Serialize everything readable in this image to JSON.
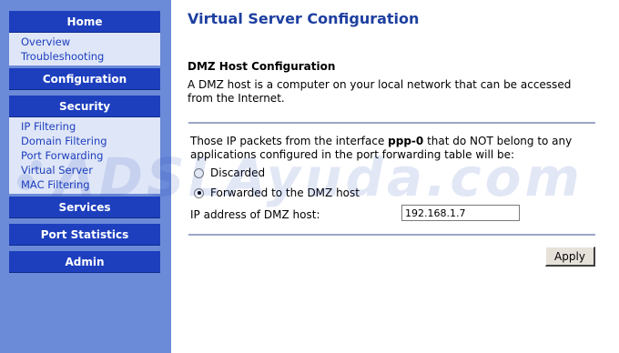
{
  "sidebar": {
    "home": {
      "label": "Home",
      "items": [
        "Overview",
        "Troubleshooting"
      ]
    },
    "configuration": {
      "label": "Configuration"
    },
    "security": {
      "label": "Security",
      "items": [
        "IP Filtering",
        "Domain Filtering",
        "Port Forwarding",
        "Virtual Server",
        "MAC Filtering"
      ]
    },
    "services": {
      "label": "Services"
    },
    "port_statistics": {
      "label": "Port Statistics"
    },
    "admin": {
      "label": "Admin"
    }
  },
  "main": {
    "title": "Virtual Server Configuration",
    "section_title": "DMZ Host Configuration",
    "description": "A DMZ host is a computer on your local network that can be accessed from the Internet.",
    "intro_prefix": "Those IP packets from the interface ",
    "interface": "ppp-0",
    "intro_suffix": " that do NOT belong to any applications configured in the port forwarding table will be:",
    "option_discarded": "Discarded",
    "option_forwarded": "Forwarded to the DMZ host",
    "selected_option": "forwarded",
    "ip_label": "IP address of DMZ host:",
    "ip_value": "192.168.1.7",
    "apply_label": "Apply"
  },
  "watermark": "ADSLAyuda.com",
  "colors": {
    "sidebar_bg": "#6b8ad8",
    "header_bg": "#1d3fbe",
    "submenu_bg": "#dfe6f7",
    "title": "#1d3fa0"
  }
}
